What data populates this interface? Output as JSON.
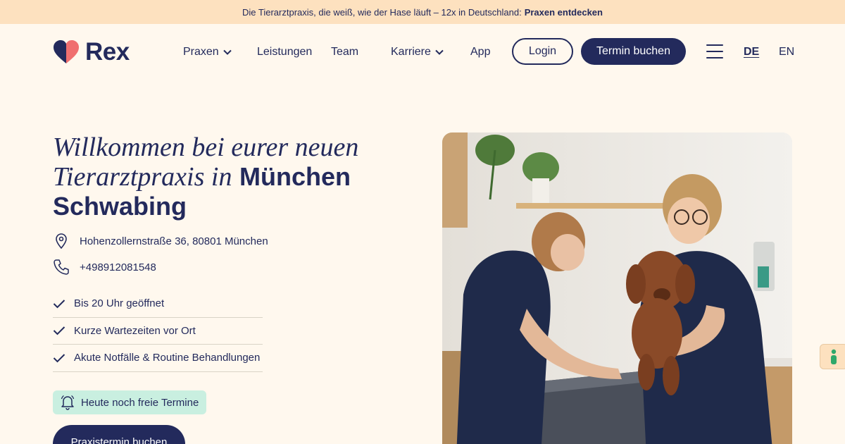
{
  "banner": {
    "text": "Die Tierarztpraxis, die weiß, wie der Hase läuft – 12x in Deutschland:",
    "link": "Praxen entdecken"
  },
  "nav": {
    "logo_text": "Rex",
    "items": [
      {
        "label": "Praxen"
      },
      {
        "label": "Leistungen"
      },
      {
        "label": "Team"
      },
      {
        "label": "Karriere"
      },
      {
        "label": "App"
      }
    ],
    "login_label": "Login",
    "book_label": "Termin buchen",
    "languages": [
      "DE",
      "EN"
    ],
    "active_language": "DE"
  },
  "hero": {
    "title_serif": "Willkommen bei eurer neuen Tierarztpraxis in",
    "title_bold_1": "München",
    "title_bold_2": "Schwabing",
    "address": "Hohenzollernstraße 36, 80801 München",
    "phone": "+498912081548",
    "features": [
      "Bis 20 Uhr geöffnet",
      "Kurze Wartezeiten vor Ort",
      "Akute Notfälle & Routine Behandlungen"
    ],
    "availability": "Heute noch freie Termine",
    "cta_label": "Praxistermin buchen"
  },
  "icons": {
    "logo": "heart-icon",
    "address": "map-pin-icon",
    "phone": "phone-icon",
    "feature": "check-icon",
    "availability": "bell-icon",
    "accessibility": "accessibility-icon",
    "menu": "hamburger-icon",
    "dropdown": "chevron-down-icon"
  },
  "colors": {
    "navy": "#232a5c",
    "background": "#fff8ee",
    "banner": "#fde1bf",
    "heart": "#f06f6f",
    "pill": "#c9efe0"
  }
}
